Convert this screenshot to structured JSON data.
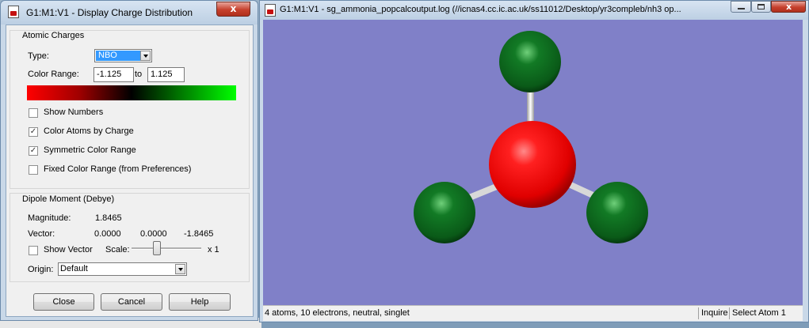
{
  "dialog": {
    "title": "G1:M1:V1 - Display Charge Distribution",
    "close_glyph": "x",
    "atomic_charges": {
      "group_label": "Atomic Charges",
      "type_label": "Type:",
      "type_value": "NBO",
      "color_range_label": "Color Range:",
      "range_min": "-1.125",
      "range_to": "to",
      "range_max": "1.125",
      "gradient_colors": [
        "#ff0000",
        "#000000",
        "#00ff00"
      ],
      "options": [
        {
          "label": "Show Numbers",
          "checked": false
        },
        {
          "label": "Color Atoms by Charge",
          "checked": true
        },
        {
          "label": "Symmetric Color Range",
          "checked": true
        },
        {
          "label": "Fixed Color Range (from Preferences)",
          "checked": false
        }
      ]
    },
    "dipole": {
      "group_label": "Dipole Moment (Debye)",
      "magnitude_label": "Magnitude:",
      "magnitude_value": "1.8465",
      "vector_label": "Vector:",
      "vector_x": "0.0000",
      "vector_y": "0.0000",
      "vector_z": "-1.8465",
      "show_vector_label": "Show Vector",
      "show_vector_checked": false,
      "scale_label": "Scale:",
      "scale_value": "x 1",
      "origin_label": "Origin:",
      "origin_value": "Default"
    },
    "buttons": {
      "close": "Close",
      "cancel": "Cancel",
      "help": "Help"
    }
  },
  "viewer": {
    "title": "G1:M1:V1 - sg_ammonia_popcalcoutput.log (//icnas4.cc.ic.ac.uk/ss11012/Desktop/yr3compleb/nh3 op...",
    "background_color": "#8080c8",
    "atoms": [
      {
        "element": "N",
        "color": "#ff0000"
      },
      {
        "element": "H",
        "color": "#0a6a1a"
      },
      {
        "element": "H",
        "color": "#0a6a1a"
      },
      {
        "element": "H",
        "color": "#0a6a1a"
      }
    ],
    "status": {
      "info": "4 atoms, 10 electrons, neutral, singlet",
      "mode": "Inquire",
      "action": "Select Atom 1"
    }
  }
}
